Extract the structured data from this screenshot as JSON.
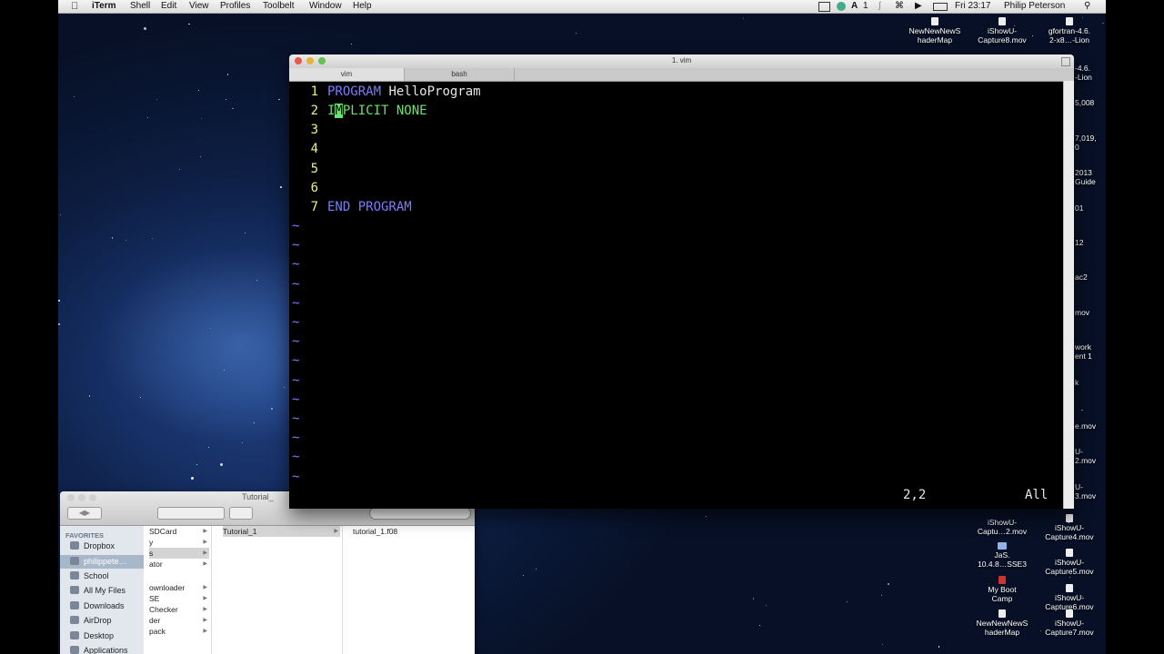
{
  "menubar": {
    "apple": "",
    "items": [
      "iTerm",
      "Shell",
      "Edit",
      "View",
      "Profiles",
      "Toolbelt",
      "Window",
      "Help"
    ],
    "status_one": "1",
    "clock": "Fri 23:17",
    "user": "Philip Peterson",
    "search_icon": "search-icon"
  },
  "desktop_icons": [
    {
      "line1": "NewNewNewS",
      "line2": "haderMap"
    },
    {
      "line1": "iShowU-",
      "line2": "Capture8.mov"
    },
    {
      "line1": "gfortran-4.6.",
      "line2": "2-x8…-Lion"
    },
    {
      "line1": "iShowU-",
      "line2": "Captu…2.mov"
    },
    {
      "line1": "iShowU-",
      "line2": "Capture4.mov"
    },
    {
      "line1": "JaS.",
      "line2": "10.4.8…SSE3"
    },
    {
      "line1": "iShowU-",
      "line2": "Capture5.mov"
    },
    {
      "line1": "My Boot",
      "line2": "Camp"
    },
    {
      "line1": "iShowU-",
      "line2": "Capture6.mov"
    },
    {
      "line1": "NewNewNewS",
      "line2": "haderMap"
    },
    {
      "line1": "iShowU-",
      "line2": "Capture7.mov"
    }
  ],
  "desktop_cut_labels": [
    "-4.6.",
    "-Lion",
    "5,008",
    "7,019,",
    "0",
    "2013",
    "Guide",
    "01",
    "12",
    "ac2",
    "mov",
    "work",
    "ent 1",
    "k",
    "e.mov",
    "U-",
    "2.mov",
    "U-",
    "3.mov"
  ],
  "terminal": {
    "title": "1. vim",
    "tabs": [
      "vim",
      "bash"
    ],
    "lines": [
      {
        "num": "1",
        "kw": "PROGRAM",
        "rest": " HelloProgram"
      },
      {
        "num": "2",
        "first": "I",
        "cursor": "M",
        "rest": "PLICIT NONE"
      },
      {
        "num": "3"
      },
      {
        "num": "4"
      },
      {
        "num": "5"
      },
      {
        "num": "6"
      },
      {
        "num": "7",
        "kw": "END PROGRAM"
      }
    ],
    "tilde": "~",
    "status_position": "2,2",
    "status_scroll": "All"
  },
  "finder": {
    "title": "Tutorial_",
    "favorites_label": "FAVORITES",
    "sidebar": [
      "Dropbox",
      "philippete…",
      "School",
      "All My Files",
      "Downloads",
      "AirDrop",
      "Desktop",
      "Applications"
    ],
    "column1": [
      "SDCard",
      "y",
      "s",
      "ator",
      "ownloader",
      "SE",
      "Checker",
      "der",
      "pack"
    ],
    "column2": [
      "Tutorial_1"
    ],
    "column3": [
      "tutorial_1.f08"
    ]
  }
}
